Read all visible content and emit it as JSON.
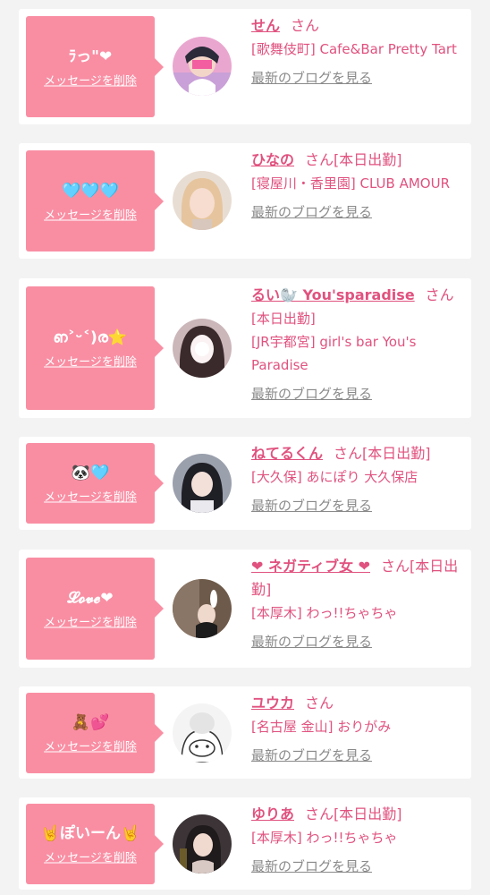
{
  "delete_label": "メッセージを削除",
  "blog_label": "最新のブログを見る",
  "san": "さん",
  "colors": {
    "accent": "#e0527f",
    "message_box": "#f98ea3",
    "link_gray": "#8a8a8a"
  },
  "cards": [
    {
      "message": "ﾗっ\"❤",
      "name": "せん",
      "status": "",
      "shop": "[歌舞伎町] Cafe&Bar Pretty Tart",
      "avatar": "avatar-photo"
    },
    {
      "message": "🩵🩵🩵",
      "name": "ひなの",
      "status": "[本日出勤]",
      "shop": "[寝屋川・香里園] CLUB AMOUR",
      "avatar": "avatar-photo"
    },
    {
      "message": "ഩ˃ᵕ˂)ര⭐",
      "name": "るい🦭 You'sparadise",
      "status": "",
      "status_line": "[本日出勤]",
      "shop": "[JR宇都宮] girl's bar You's Paradise",
      "avatar": "avatar-photo"
    },
    {
      "message": "🐼🩵",
      "name": "ねてるくん",
      "status": "[本日出勤]",
      "shop": "[大久保] あにぽり 大久保店",
      "avatar": "avatar-photo"
    },
    {
      "message": "𝓛𝓸𝓿𝓮❤",
      "name": "❤ ネガティブ女 ❤",
      "status": "[本日出勤]",
      "shop": "[本厚木] わっ!!ちゃちゃ",
      "avatar": "avatar-photo"
    },
    {
      "message": "🧸💕",
      "name": "ユウカ",
      "status": "",
      "shop": "[名古屋 金山] おりがみ",
      "avatar": "avatar-illustration"
    },
    {
      "message": "🤘ぽいーん🤘",
      "name": "ゆりあ",
      "status": "[本日出勤]",
      "shop": "[本厚木] わっ!!ちゃちゃ",
      "avatar": "avatar-photo"
    }
  ]
}
